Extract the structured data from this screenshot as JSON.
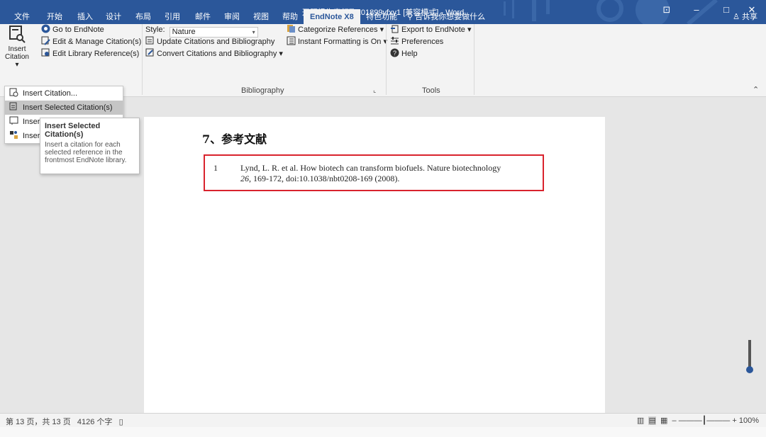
{
  "window": {
    "title": "开题报告表颜飞201899yfxy1 [兼容模式] - Word",
    "controls": [
      "⊡",
      "–",
      "□",
      "✕"
    ]
  },
  "tabs": [
    {
      "label": "文件"
    },
    {
      "label": "开始"
    },
    {
      "label": "插入"
    },
    {
      "label": "设计"
    },
    {
      "label": "布局"
    },
    {
      "label": "引用"
    },
    {
      "label": "邮件"
    },
    {
      "label": "审阅"
    },
    {
      "label": "视图"
    },
    {
      "label": "帮助"
    },
    {
      "label": "EndNote X8"
    },
    {
      "label": "特色功能"
    },
    {
      "label": "告诉我你想要做什么"
    }
  ],
  "share_label": "共享",
  "ribbon": {
    "insert_citation": {
      "line1": "Insert",
      "line2": "Citation"
    },
    "citations": {
      "go_to": "Go to EndNote",
      "edit_manage": "Edit & Manage Citation(s)",
      "edit_library": "Edit Library Reference(s)"
    },
    "bibliography": {
      "style_label": "Style:",
      "style_value": "Nature",
      "update": "Update Citations and Bibliography",
      "convert": "Convert Citations and Bibliography",
      "group_label": "Bibliography"
    },
    "formatting": {
      "categorize": "Categorize References",
      "instant": "Instant Formatting is On"
    },
    "tools": {
      "export": "Export to EndNote",
      "preferences": "Preferences",
      "help": "Help",
      "group_label": "Tools"
    }
  },
  "menu": {
    "items": [
      {
        "label": "Insert Citation..."
      },
      {
        "label": "Insert Selected Citation(s)"
      },
      {
        "label": "Inser"
      },
      {
        "label": "Inser"
      }
    ]
  },
  "tooltip": {
    "title": "Insert Selected Citation(s)",
    "body": "Insert a citation for each selected reference in the frontmost EndNote library."
  },
  "document": {
    "heading": "7、参考文献",
    "reference": {
      "number": "1",
      "line1": "Lynd, L. R. et al. How biotech can transform biofuels. Nature biotechnology",
      "volume": "26",
      "line2_rest": ", 169-172, doi:10.1038/nbt0208-169 (2008)."
    }
  },
  "status": {
    "page_info": "第 13 页，共 13 页",
    "word_count": "4126 个字",
    "zoom": "+ 100%"
  },
  "colors": {
    "word_blue": "#2b579a",
    "highlight_border": "#d9232d"
  }
}
